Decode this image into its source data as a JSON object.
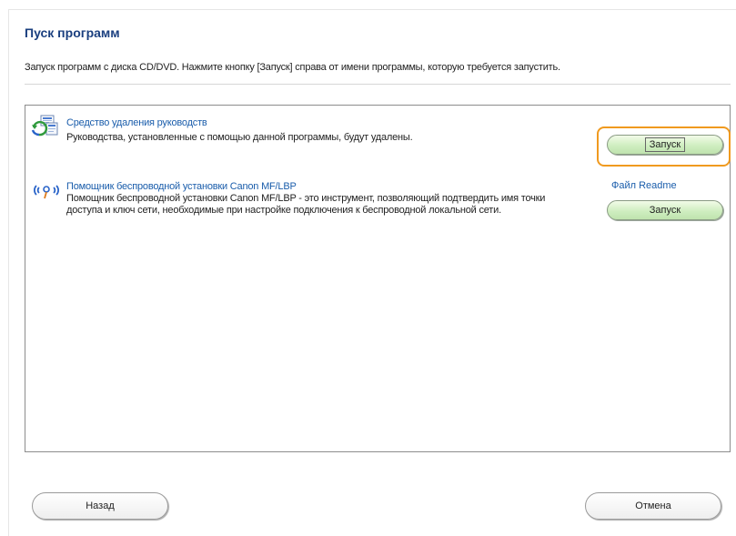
{
  "header": {
    "title": "Пуск программ",
    "subtitle": "Запуск программ с диска CD/DVD. Нажмите кнопку [Запуск] справа от имени программы, которую требуется запустить."
  },
  "programs": [
    {
      "name": "Средство удаления руководств",
      "description": "Руководства, установленные с помощью данной программы, будут удалены.",
      "launch_label": "Запуск",
      "icon": "uninstall-manuals-icon"
    },
    {
      "name": "Помощник беспроводной установки Canon MF/LBP",
      "description": "Помощник беспроводной установки Canon MF/LBP - это инструмент, позволяющий подтвердить имя точки доступа и ключ сети, необходимые при настройке подключения к беспроводной локальной сети.",
      "readme_label": "Файл Readme",
      "launch_label": "Запуск",
      "icon": "wireless-icon"
    }
  ],
  "footer": {
    "back_label": "Назад",
    "cancel_label": "Отмена"
  },
  "colors": {
    "title": "#1a3f7f",
    "link": "#1a5dab",
    "highlight": "#f09a1f",
    "launch_button": "#cfeec0"
  }
}
